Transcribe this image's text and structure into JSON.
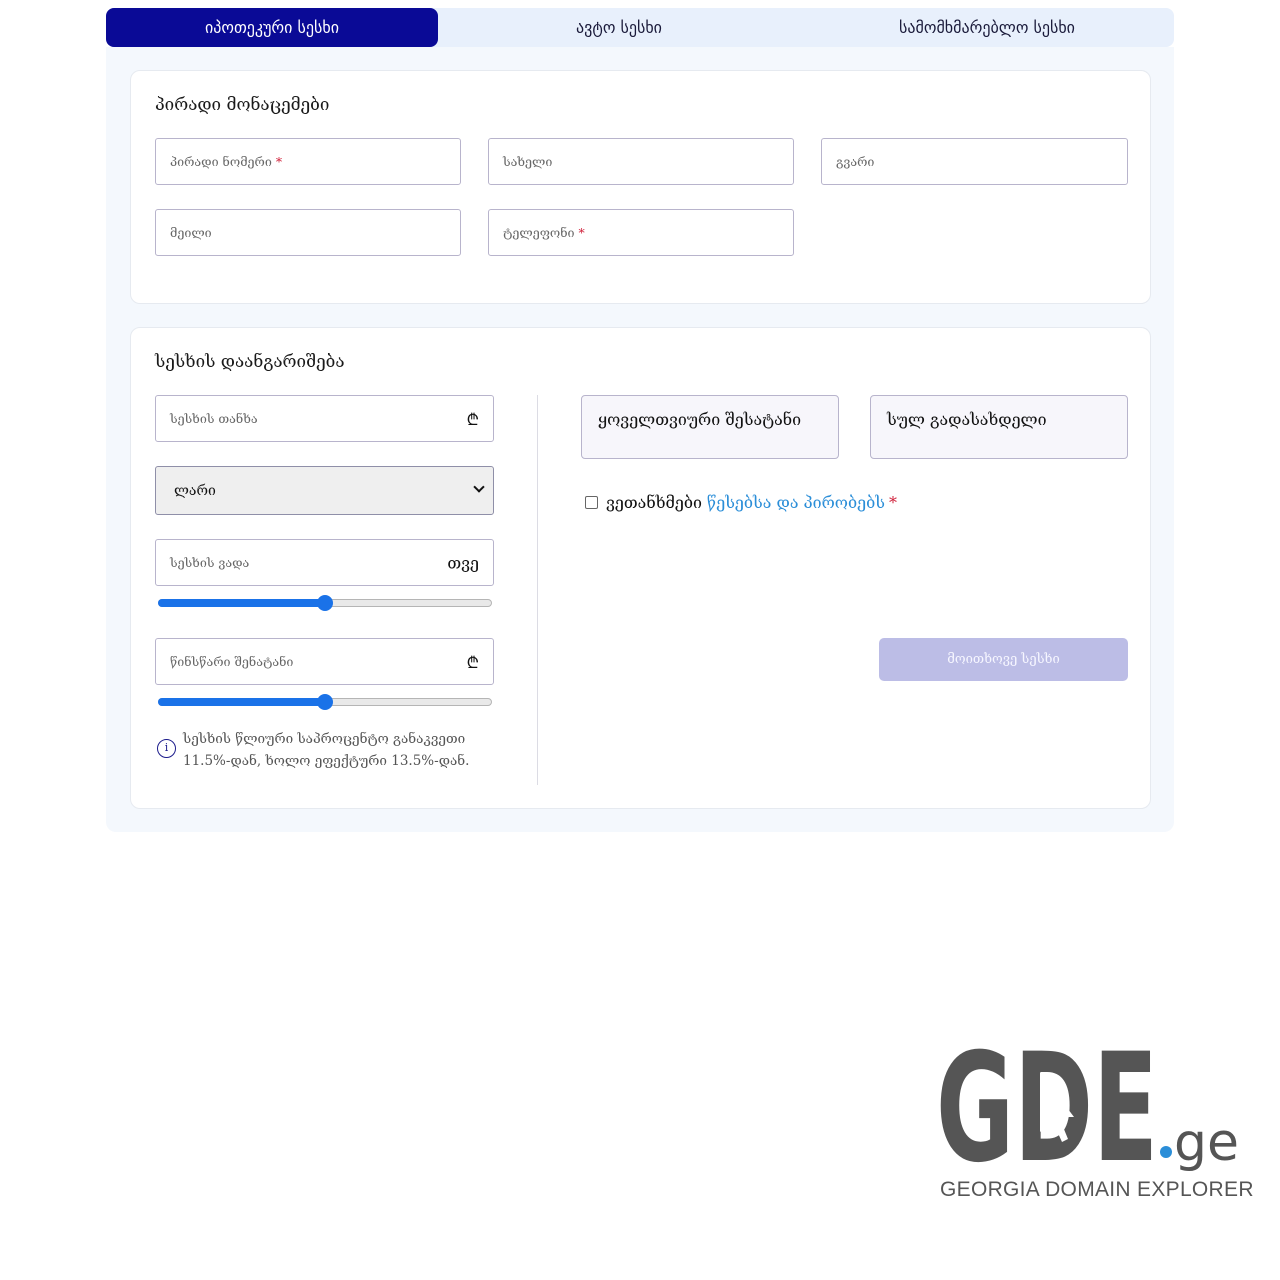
{
  "tabs": [
    {
      "label": "იპოთეკური სესხი"
    },
    {
      "label": "ავტო სესხი"
    },
    {
      "label": "სამომხმარებლო სესხი"
    }
  ],
  "personal": {
    "title": "პირადი მონაცემები",
    "fields": {
      "personal_number": {
        "placeholder": "პირადი ნომერი",
        "required": "*"
      },
      "first_name": {
        "placeholder": "სახელი"
      },
      "last_name": {
        "placeholder": "გვარი"
      },
      "email": {
        "placeholder": "მეილი"
      },
      "phone": {
        "placeholder": "ტელეფონი",
        "required": "*"
      }
    }
  },
  "calculator": {
    "title": "სესხის დაანგარიშება",
    "amount": {
      "placeholder": "სესხის თანხა",
      "unit": "₾"
    },
    "currency": {
      "selected": "ლარი"
    },
    "term": {
      "placeholder": "სესხის ვადა",
      "unit": "თვე",
      "slider_fraction": 0.5
    },
    "down_payment": {
      "placeholder": "წინსწარი შენატანი",
      "unit": "₾",
      "slider_fraction": 0.5
    },
    "note": "სესხის წლიური საპროცენტო განაკვეთი 11.5%-დან, ხოლო ეფექტური 13.5%-დან.",
    "info_icon": "i",
    "monthly_payment_label": "ყოველთვიური შესატანი",
    "total_payable_label": "სულ გადასახდელი",
    "agree": {
      "text": "ვეთანხმები",
      "link": "წესებსა და პირობებს",
      "required": "*"
    },
    "submit_label": "მოითხოვე სესხი"
  },
  "logo": {
    "mark": "GDE",
    "tld": ".ge",
    "tagline": "GEORGIA DOMAIN EXPLORER",
    "colors": {
      "mark": "#555555",
      "dot": "#2b8ed8"
    }
  },
  "colors": {
    "accent": "#0a0a96",
    "slider": "#1a72e8",
    "link": "#2b8ed8",
    "required": "#d0203a",
    "submit_disabled": "#bcbde6"
  }
}
